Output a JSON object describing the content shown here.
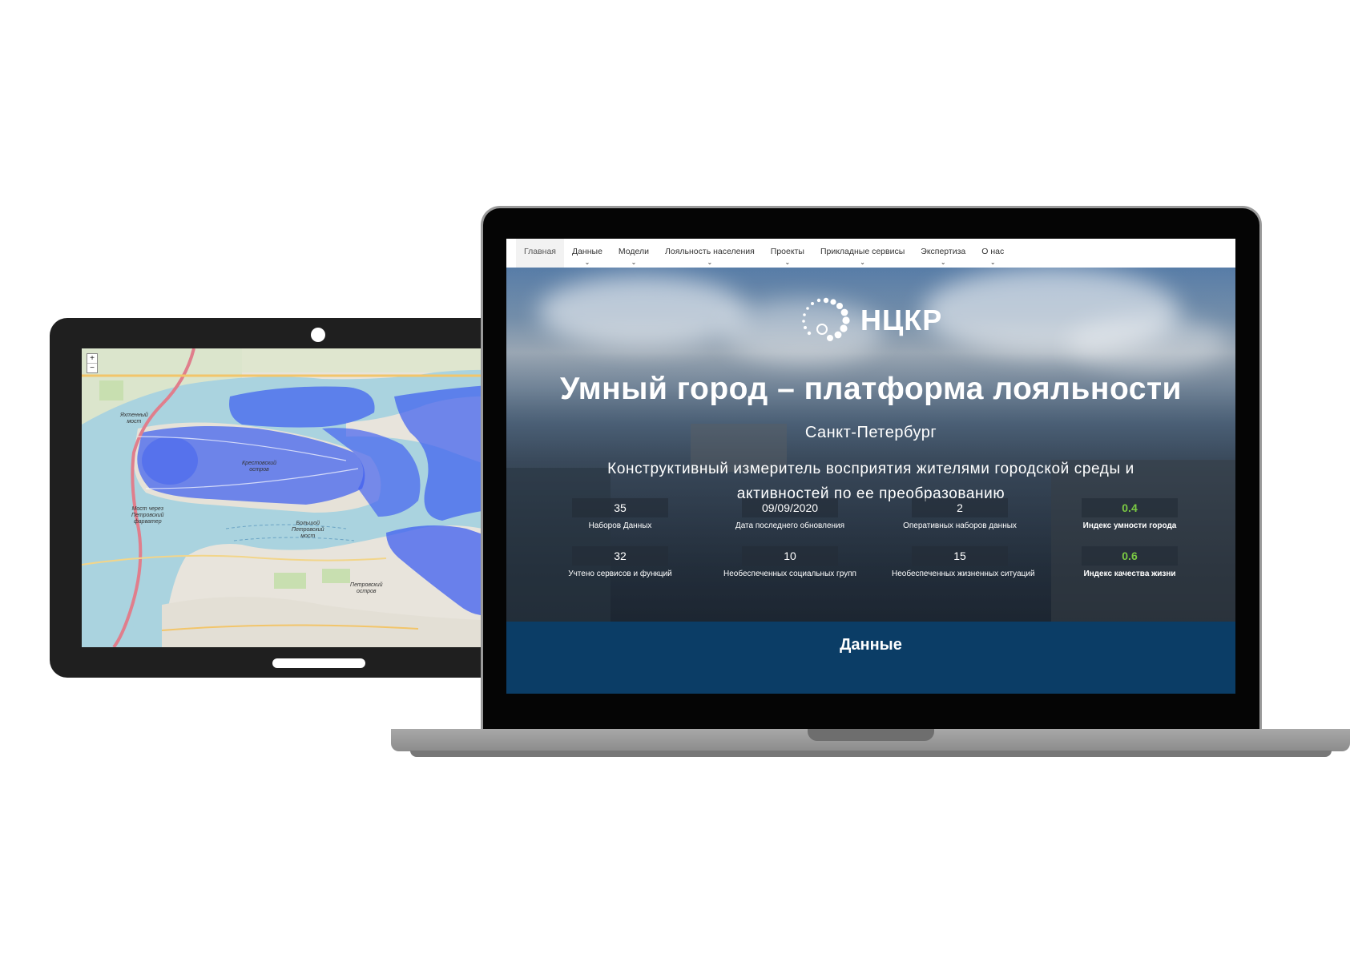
{
  "tablet": {
    "map": {
      "zoom_in": "+",
      "zoom_out": "−",
      "labels": {
        "krestovsky": "Крестовский\nостров",
        "petrovsky": "Петровский\nостров",
        "bridge_left": "Мост через\nПетровский\nфарватер",
        "yacht_bridge": "Яхтенный\nмост",
        "bolshoy_bridge": "Большой\nПетровский\nмост"
      }
    }
  },
  "laptop": {
    "nav": {
      "items": [
        {
          "label": "Главная",
          "dropdown": false,
          "active": true
        },
        {
          "label": "Данные",
          "dropdown": true,
          "active": false
        },
        {
          "label": "Модели",
          "dropdown": true,
          "active": false
        },
        {
          "label": "Лояльность населения",
          "dropdown": true,
          "active": false
        },
        {
          "label": "Проекты",
          "dropdown": true,
          "active": false
        },
        {
          "label": "Прикладные сервисы",
          "dropdown": true,
          "active": false
        },
        {
          "label": "Экспертиза",
          "dropdown": true,
          "active": false
        },
        {
          "label": "О нас",
          "dropdown": true,
          "active": false
        }
      ],
      "chevron": "⌄"
    },
    "hero": {
      "logo_text": "НЦКР",
      "title": "Умный город – платформа лояльности",
      "city": "Санкт-Петербург",
      "description": "Конструктивный измеритель восприятия жителями городской среды и активностей по ее преобразованию"
    },
    "stats": {
      "row1": [
        {
          "value": "35",
          "label": "Наборов Данных",
          "accent": false
        },
        {
          "value": "09/09/2020",
          "label": "Дата последнего обновления",
          "accent": false
        },
        {
          "value": "2",
          "label": "Оперативных наборов данных",
          "accent": false
        },
        {
          "value": "0.4",
          "label": "Индекс умности города",
          "accent": true
        }
      ],
      "row2": [
        {
          "value": "32",
          "label": "Учтено сервисов и функций",
          "accent": false
        },
        {
          "value": "10",
          "label": "Необеспеченных социальных групп",
          "accent": false
        },
        {
          "value": "15",
          "label": "Необеспеченных жизненных ситуаций",
          "accent": false
        },
        {
          "value": "0.6",
          "label": "Индекс качества жизни",
          "accent": true
        }
      ]
    },
    "section": {
      "title": "Данные"
    }
  },
  "colors": {
    "accent_green": "#7ac943",
    "section_blue": "#0b3d66",
    "overlay_blue": "#3f5ff0"
  }
}
